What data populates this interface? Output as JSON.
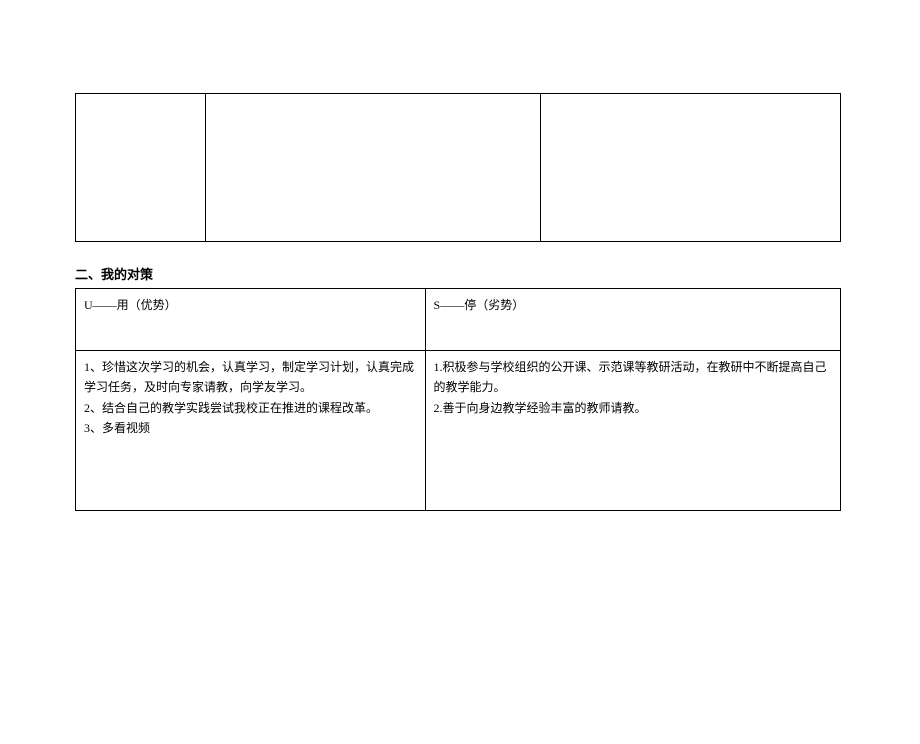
{
  "section_title": "二、我的对策",
  "strategy_table": {
    "headers": {
      "u_header": "U——用（优势）",
      "s_header": "S——停（劣势）"
    },
    "content": {
      "u_content": "1、珍惜这次学习的机会，认真学习，制定学习计划，认真完成学习任务，及时向专家请教，向学友学习。\n2、结合自己的教学实践尝试我校正在推进的课程改革。\n3、多看视频",
      "s_content": "1.积极参与学校组织的公开课、示范课等教研活动，在教研中不断提高自己的教学能力。\n2.善于向身边教学经验丰富的教师请教。"
    }
  }
}
